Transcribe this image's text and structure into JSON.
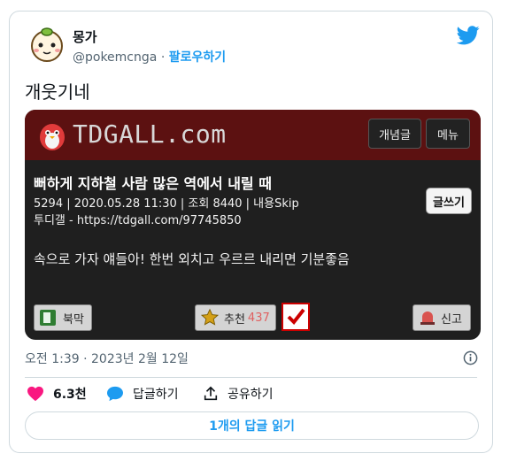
{
  "tweet": {
    "author_name": "몽가",
    "handle": "@pokemcnga",
    "separator": "·",
    "follow_label": "팔로우하기",
    "text": "개웃기네",
    "timestamp": "오전 1:39 · 2023년 2월 12일",
    "likes_count": "6.3천",
    "reply_label": "답글하기",
    "share_label": "공유하기",
    "read_replies_label": "1개의 답글 읽기"
  },
  "media": {
    "logo_text": "TDGALL.com",
    "header_buttons": [
      "개념글",
      "메뉴"
    ],
    "post_title": "뻐하게 지하철 사람 많은 역에서 내릴 때",
    "post_meta_line1": "5294 | 2020.05.28 11:30 | 조회 8440 | 내용Skip",
    "post_meta_line2": "투디갤 - https://tdgall.com/97745850",
    "write_label": "글쓰기",
    "post_body": "속으로 가자 얘들아! 한번 외치고 우르르 내리면 기분좋음",
    "bookmark_label": "북막",
    "recommend_label": "추천",
    "recommend_count": "437",
    "report_label": "신고"
  },
  "colors": {
    "accent": "#1d9bf0",
    "like": "#f91880",
    "banner": "#5c1111"
  },
  "icons": [
    "avatar-hamster",
    "twitter-bird-icon",
    "heart-icon",
    "reply-bubble-icon",
    "share-icon",
    "info-icon",
    "star-icon",
    "checkmark-icon",
    "bookmark-icon",
    "siren-icon"
  ]
}
